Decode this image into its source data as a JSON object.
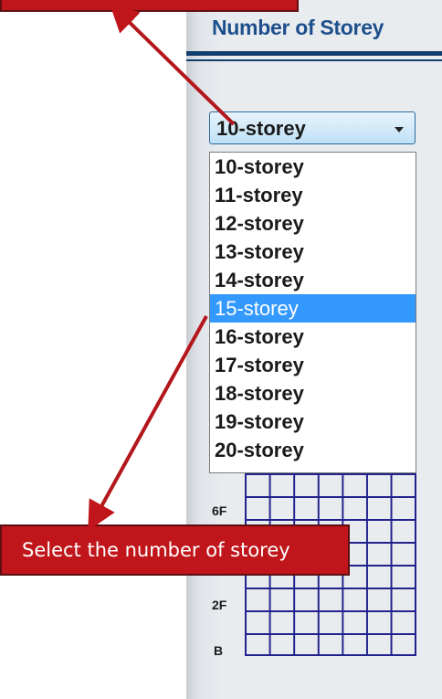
{
  "panel": {
    "title": "Number of Storey"
  },
  "combo": {
    "selected_value": "10-storey"
  },
  "dropdown": {
    "options": [
      "10-storey",
      "11-storey",
      "12-storey",
      "13-storey",
      "14-storey",
      "15-storey",
      "16-storey",
      "17-storey",
      "18-storey",
      "19-storey",
      "20-storey"
    ],
    "highlighted": "15-storey"
  },
  "grid": {
    "floor_labels": [
      "6F",
      "2F",
      "B"
    ]
  },
  "callout": {
    "text": "Select the number of storey"
  },
  "colors": {
    "callout_bg": "#c0161b",
    "highlight": "#3399ff",
    "title_text": "#1d4f8c",
    "grid_lines": "#22228f"
  }
}
